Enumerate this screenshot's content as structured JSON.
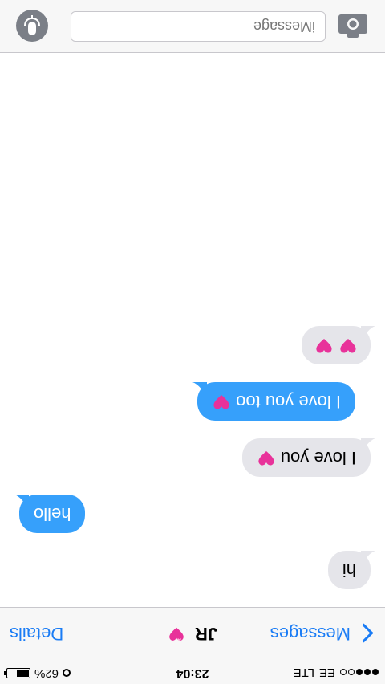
{
  "status": {
    "carrier": "EE",
    "network": "LTE",
    "time": "23:04",
    "battery": "62%",
    "battery_level": 0.62
  },
  "nav": {
    "back_label": "Messages",
    "title": "JR",
    "details_label": "Details"
  },
  "messages": [
    {
      "from": "me",
      "text": "hi"
    },
    {
      "from": "them",
      "text": "hello"
    },
    {
      "from": "me",
      "text": "I love you"
    },
    {
      "from": "them",
      "text": "I love you too"
    },
    {
      "from": "me",
      "text": ""
    }
  ],
  "input": {
    "placeholder": "iMessage"
  },
  "colors": {
    "accent": "#1a7cf5",
    "sent_bubble": "#36a0fb",
    "received_bubble": "#e5e5ea",
    "heart": "#e8329a"
  },
  "icons": {
    "back": "chevron-left-icon",
    "camera": "camera-icon",
    "mic": "microphone-icon",
    "emoji": "pink-heart-emoji"
  }
}
